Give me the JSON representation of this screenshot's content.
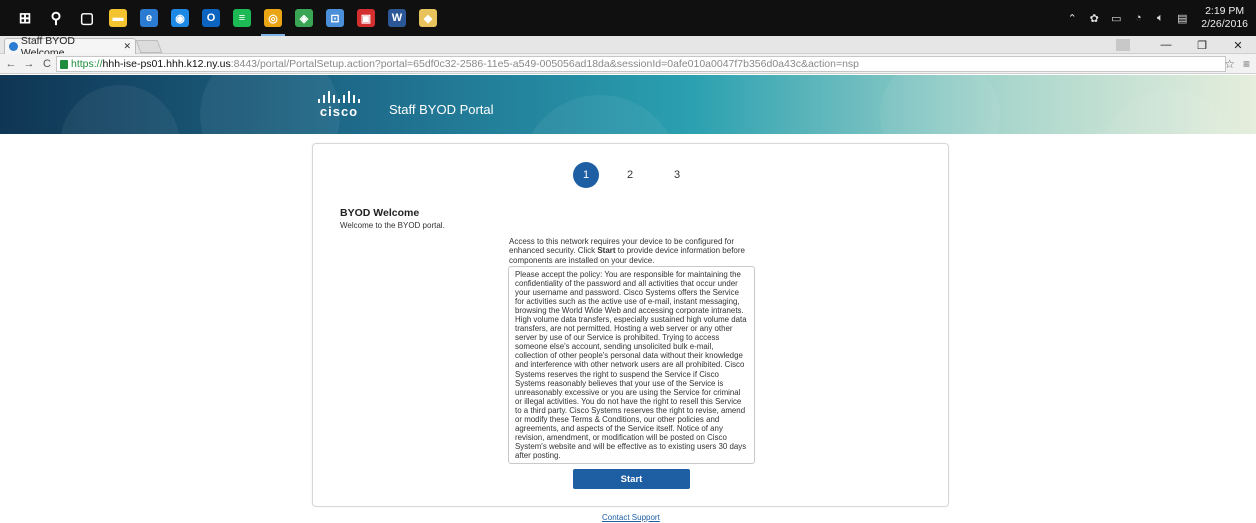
{
  "taskbar": {
    "icons": [
      {
        "name": "windows-start-icon",
        "color": "#ffffff",
        "glyph": "⊞"
      },
      {
        "name": "search-icon",
        "color": "#ffffff",
        "glyph": "⚲"
      },
      {
        "name": "task-view-icon",
        "color": "#ffffff",
        "glyph": "▢"
      },
      {
        "name": "file-explorer-icon",
        "color": "#f4c430",
        "glyph": "▬"
      },
      {
        "name": "edge-icon",
        "color": "#2a7bd1",
        "glyph": "e"
      },
      {
        "name": "remote-icon",
        "color": "#1e88e5",
        "glyph": "◉"
      },
      {
        "name": "outlook-icon",
        "color": "#0a64c0",
        "glyph": "O"
      },
      {
        "name": "spotify-icon",
        "color": "#1db954",
        "glyph": "≡"
      },
      {
        "name": "chrome-icon",
        "color": "#e9a514",
        "glyph": "◎"
      },
      {
        "name": "app-green-icon",
        "color": "#3aa655",
        "glyph": "◈"
      },
      {
        "name": "network-app-icon",
        "color": "#4a8fd8",
        "glyph": "⊡"
      },
      {
        "name": "app-red-icon",
        "color": "#d32f2f",
        "glyph": "▣"
      },
      {
        "name": "word-icon",
        "color": "#2b5797",
        "glyph": "W"
      },
      {
        "name": "app-folder-icon",
        "color": "#e8c25a",
        "glyph": "◆"
      }
    ],
    "clock_time": "2:19 PM",
    "clock_date": "2/26/2016"
  },
  "browser": {
    "tab_title": "Staff BYOD Welcome",
    "url_scheme": "https://",
    "url_host": "hhh-ise-ps01.hhh.k12.ny.us",
    "url_rest": ":8443/portal/PortalSetup.action?portal=65df0c32-2586-11e5-a549-005056ad18da&sessionId=0afe010a0047f7b356d0a43c&action=nsp"
  },
  "portal": {
    "logo_text": "cisco",
    "title": "Staff BYOD Portal",
    "steps": [
      "1",
      "2",
      "3"
    ],
    "active_step": 1,
    "welcome_title": "BYOD Welcome",
    "welcome_sub": "Welcome to the BYOD portal.",
    "intro_before": "Access to this network requires your device to be configured for enhanced security. Click ",
    "intro_strong": "Start",
    "intro_after": " to provide device information before components are installed on your device.",
    "aup": "Please accept the policy: You are responsible for maintaining the confidentiality of the password and all activities that occur under your username and password. Cisco Systems offers the Service for activities such as the active use of e-mail, instant messaging, browsing the World Wide Web and accessing corporate intranets. High volume data transfers, especially sustained high volume data transfers, are not permitted. Hosting a web server or any other server by use of our Service is prohibited. Trying to access someone else's account, sending unsolicited bulk e-mail, collection of other people's personal data without their knowledge and interference with other network users are all prohibited. Cisco Systems reserves the right to suspend the Service if Cisco Systems reasonably believes that your use of the Service is unreasonably excessive or you are using the Service for criminal or illegal activities. You do not have the right to resell this Service to a third party. Cisco Systems reserves the right to revise, amend or modify these Terms & Conditions, our other policies and agreements, and aspects of the Service itself. Notice of any revision, amendment, or modification will be posted on Cisco System's website and will be effective as to existing users 30 days after posting.",
    "start_label": "Start",
    "contact_label": "Contact Support"
  }
}
